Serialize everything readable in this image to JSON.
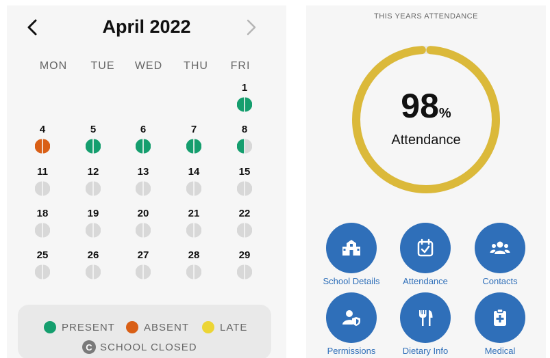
{
  "calendar": {
    "month_title": "April 2022",
    "prev_icon": "chevron-left-icon",
    "next_icon": "chevron-right-icon",
    "weekdays": [
      "MON",
      "TUE",
      "WED",
      "THU",
      "FRI"
    ],
    "days": [
      {
        "day": "1",
        "col": 4,
        "row": 0,
        "status": "present"
      },
      {
        "day": "4",
        "col": 0,
        "row": 1,
        "status": "absent"
      },
      {
        "day": "5",
        "col": 1,
        "row": 1,
        "status": "present"
      },
      {
        "day": "6",
        "col": 2,
        "row": 1,
        "status": "present"
      },
      {
        "day": "7",
        "col": 3,
        "row": 1,
        "status": "present"
      },
      {
        "day": "8",
        "col": 4,
        "row": 1,
        "status": "half-present"
      },
      {
        "day": "11",
        "col": 0,
        "row": 2,
        "status": "none"
      },
      {
        "day": "12",
        "col": 1,
        "row": 2,
        "status": "none"
      },
      {
        "day": "13",
        "col": 2,
        "row": 2,
        "status": "none"
      },
      {
        "day": "14",
        "col": 3,
        "row": 2,
        "status": "none"
      },
      {
        "day": "15",
        "col": 4,
        "row": 2,
        "status": "none"
      },
      {
        "day": "18",
        "col": 0,
        "row": 3,
        "status": "none"
      },
      {
        "day": "19",
        "col": 1,
        "row": 3,
        "status": "none"
      },
      {
        "day": "20",
        "col": 2,
        "row": 3,
        "status": "none"
      },
      {
        "day": "21",
        "col": 3,
        "row": 3,
        "status": "none"
      },
      {
        "day": "22",
        "col": 4,
        "row": 3,
        "status": "none"
      },
      {
        "day": "25",
        "col": 0,
        "row": 4,
        "status": "none"
      },
      {
        "day": "26",
        "col": 1,
        "row": 4,
        "status": "none"
      },
      {
        "day": "27",
        "col": 2,
        "row": 4,
        "status": "none"
      },
      {
        "day": "28",
        "col": 3,
        "row": 4,
        "status": "none"
      },
      {
        "day": "29",
        "col": 4,
        "row": 4,
        "status": "none"
      }
    ]
  },
  "legend": {
    "present": "PRESENT",
    "absent": "ABSENT",
    "late": "LATE",
    "school_closed": "SCHOOL CLOSED",
    "school_closed_glyph": "C"
  },
  "attendance": {
    "section_title": "THIS YEARS ATTENDANCE",
    "value": "98",
    "unit": "%",
    "label": "Attendance",
    "fraction": 0.98
  },
  "quick_actions": [
    {
      "id": "school-details",
      "label": "School Details",
      "icon": "school-building-icon"
    },
    {
      "id": "attendance",
      "label": "Attendance",
      "icon": "calendar-check-icon"
    },
    {
      "id": "contacts",
      "label": "Contacts",
      "icon": "people-group-icon"
    },
    {
      "id": "permissions",
      "label": "Permissions",
      "icon": "user-shield-icon"
    },
    {
      "id": "dietary-info",
      "label": "Dietary Info",
      "icon": "fork-knife-icon"
    },
    {
      "id": "medical",
      "label": "Medical",
      "icon": "medical-clipboard-icon"
    }
  ],
  "colors": {
    "present": "#159e6e",
    "absent": "#d95f16",
    "late": "#ecd535",
    "none": "#d8d8d8",
    "ring": "#dbb93a",
    "ring_track": "#e8e8e8",
    "accent": "#2f6fb9"
  }
}
